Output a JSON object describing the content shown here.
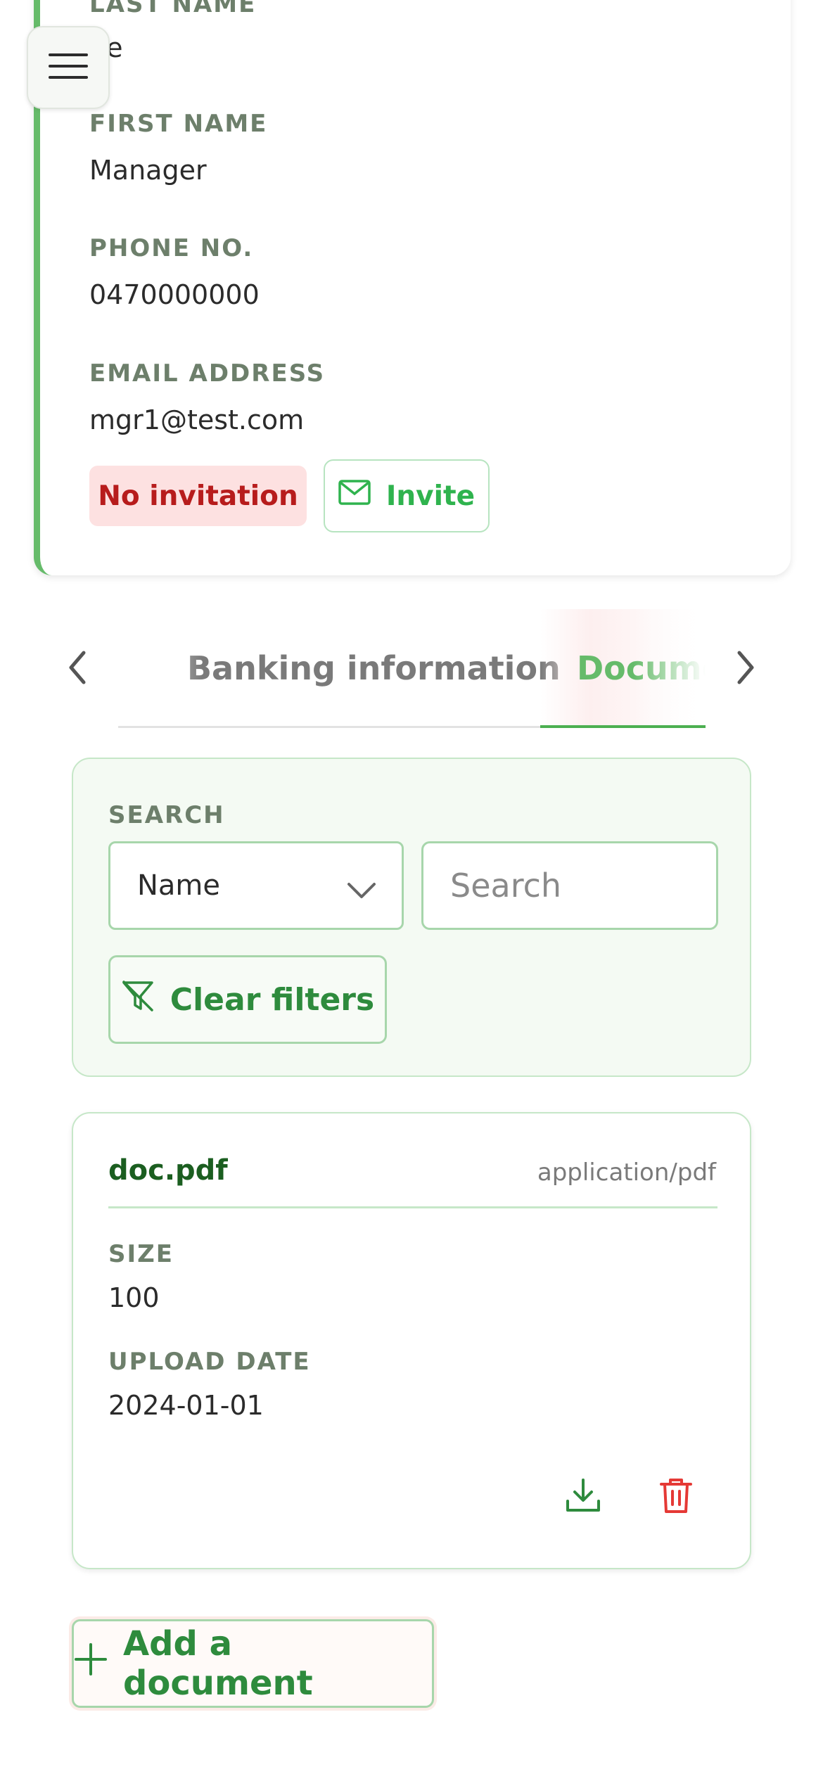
{
  "contact": {
    "last_name_label": "LAST NAME",
    "last_name_value": "ne",
    "first_name_label": "FIRST NAME",
    "first_name_value": "Manager",
    "phone_label": "PHONE NO.",
    "phone_value": "0470000000",
    "email_label": "EMAIL ADDRESS",
    "email_value": "mgr1@test.com",
    "status_badge": "No invitation",
    "invite_label": "Invite"
  },
  "tabs": {
    "items": [
      "Banking information",
      "Docume"
    ],
    "active_index": 1
  },
  "search": {
    "label": "SEARCH",
    "field_select": "Name",
    "placeholder": "Search",
    "clear_label": "Clear filters"
  },
  "document": {
    "name": "doc.pdf",
    "type": "application/pdf",
    "size_label": "SIZE",
    "size_value": "100",
    "date_label": "UPLOAD DATE",
    "date_value": "2024-01-01"
  },
  "add_label": "Add a document",
  "colors": {
    "accent": "#66bb6a",
    "primary_text": "#2e8b3d",
    "danger": "#e53935",
    "badge_bg": "#fde1e1"
  },
  "icons": [
    "menu-icon",
    "mail-icon",
    "chevron-left-icon",
    "chevron-right-icon",
    "chevron-down-icon",
    "filter-off-icon",
    "download-icon",
    "trash-icon",
    "plus-icon"
  ]
}
